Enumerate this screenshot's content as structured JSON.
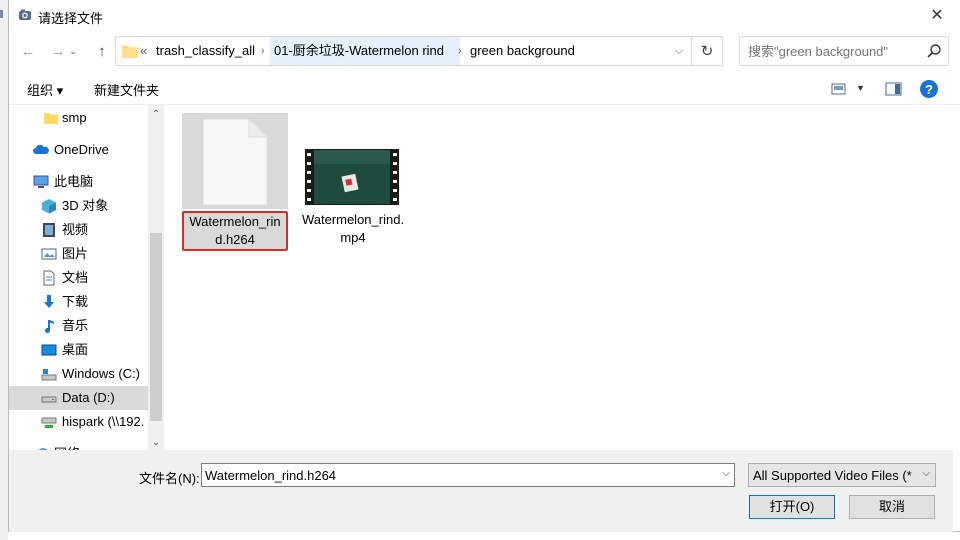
{
  "window": {
    "title": "请选择文件"
  },
  "nav": {
    "breadcrumbs": [
      "trash_classify_all",
      "01-厨余垃圾-Watermelon rind",
      "green background"
    ],
    "overflow": "«",
    "search_placeholder": "搜索\"green background\""
  },
  "toolbar": {
    "organize": "组织 ▾",
    "new_folder": "新建文件夹"
  },
  "sidebar": {
    "items": [
      {
        "label": "smp",
        "icon": "folder-icon"
      },
      {
        "label": "OneDrive",
        "icon": "cloud-icon"
      },
      {
        "label": "此电脑",
        "icon": "computer-icon"
      },
      {
        "label": "3D 对象",
        "icon": "cube-icon"
      },
      {
        "label": "视频",
        "icon": "video-icon"
      },
      {
        "label": "图片",
        "icon": "picture-icon"
      },
      {
        "label": "文档",
        "icon": "document-icon"
      },
      {
        "label": "下载",
        "icon": "download-icon"
      },
      {
        "label": "音乐",
        "icon": "music-icon"
      },
      {
        "label": "桌面",
        "icon": "desktop-icon"
      },
      {
        "label": "Windows (C:)",
        "icon": "drive-icon"
      },
      {
        "label": "Data (D:)",
        "icon": "drive-icon"
      },
      {
        "label": "hispark (\\\\192.",
        "icon": "network-drive-icon"
      },
      {
        "label": "网络",
        "icon": "network-icon"
      }
    ]
  },
  "files": [
    {
      "name": "Watermelon_rind.h264",
      "icon": "blank-file-icon",
      "selected": true
    },
    {
      "name": "Watermelon_rind.mp4",
      "icon": "video-thumbnail-icon",
      "selected": false
    }
  ],
  "footer": {
    "filename_label": "文件名(N):",
    "filename_value": "Watermelon_rind.h264",
    "filetype_value": "All Supported Video Files (*.",
    "open_label": "打开(O)",
    "cancel_label": "取消"
  }
}
